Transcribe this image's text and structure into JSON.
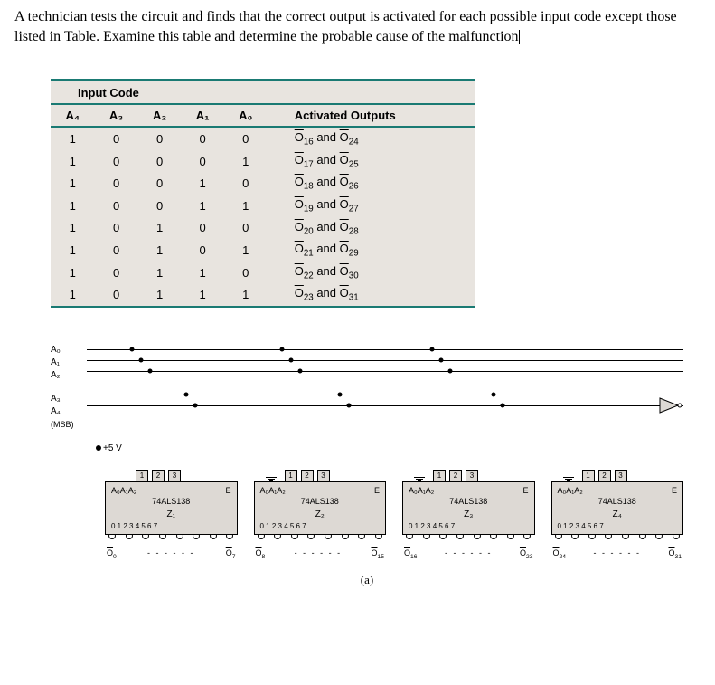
{
  "problem": {
    "text": "A technician tests the circuit and finds that the correct output is activated for each possible input code except those listed in Table. Examine this table and determine the probable cause of the malfunction"
  },
  "table": {
    "input_code_header": "Input Code",
    "activated_header": "Activated Outputs",
    "cols": {
      "a4": "A₄",
      "a3": "A₃",
      "a2": "A₂",
      "a1": "A₁",
      "a0": "A₀"
    },
    "rows": [
      {
        "a4": "1",
        "a3": "0",
        "a2": "0",
        "a1": "0",
        "a0": "0",
        "o1": "16",
        "o2": "24"
      },
      {
        "a4": "1",
        "a3": "0",
        "a2": "0",
        "a1": "0",
        "a0": "1",
        "o1": "17",
        "o2": "25"
      },
      {
        "a4": "1",
        "a3": "0",
        "a2": "0",
        "a1": "1",
        "a0": "0",
        "o1": "18",
        "o2": "26"
      },
      {
        "a4": "1",
        "a3": "0",
        "a2": "0",
        "a1": "1",
        "a0": "1",
        "o1": "19",
        "o2": "27"
      },
      {
        "a4": "1",
        "a3": "0",
        "a2": "1",
        "a1": "0",
        "a0": "0",
        "o1": "20",
        "o2": "28"
      },
      {
        "a4": "1",
        "a3": "0",
        "a2": "1",
        "a1": "0",
        "a0": "1",
        "o1": "21",
        "o2": "29"
      },
      {
        "a4": "1",
        "a3": "0",
        "a2": "1",
        "a1": "1",
        "a0": "0",
        "o1": "22",
        "o2": "30"
      },
      {
        "a4": "1",
        "a3": "0",
        "a2": "1",
        "a1": "1",
        "a0": "1",
        "o1": "23",
        "o2": "31"
      }
    ],
    "and_word": " and "
  },
  "circuit": {
    "inputs": {
      "a0": "A₀",
      "a1": "A₁",
      "a2": "A₂",
      "a3": "A₃",
      "a4": "A₄",
      "msb": "(MSB)"
    },
    "plus5v": "+5 V",
    "pin123": "1 2 3",
    "chip_part": "74ALS138",
    "chip_top_left": "A₀A₁A₂",
    "chip_e": "E",
    "bottom_pins": "0 1 2 3 4 5 6 7",
    "z": [
      "Z₁",
      "Z₂",
      "Z₃",
      "Z₄"
    ],
    "out_labels": {
      "z1_left": "0",
      "z1_right": "7",
      "z2_left": "8",
      "z2_right": "15",
      "z3_left": "16",
      "z3_right": "23",
      "z4_left": "24",
      "z4_right": "31"
    },
    "dashes": "- - - - - -",
    "fig": "(a)"
  }
}
